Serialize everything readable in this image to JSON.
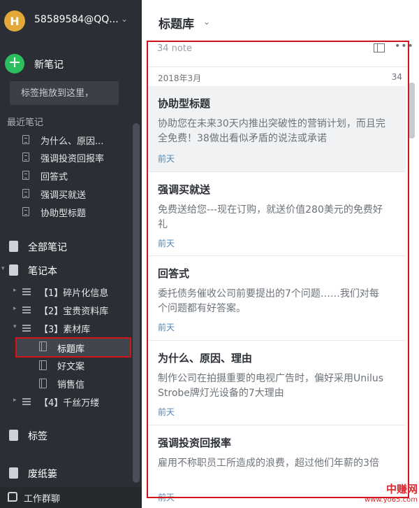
{
  "sidebar": {
    "account": "58589584@QQ...",
    "avatar_letter": "H",
    "new_note_label": "新笔记",
    "drop_hint": "标签拖放到这里，",
    "recent_label": "最近笔记",
    "recent_items": [
      {
        "label": "为什么、原因..."
      },
      {
        "label": "强调投资回报率"
      },
      {
        "label": "回答式"
      },
      {
        "label": "强调买就送"
      },
      {
        "label": "协助型标题"
      }
    ],
    "all_notes_label": "全部笔记",
    "notebooks_label": "笔记本",
    "notebooks": [
      {
        "label": "【1】碎片化信息"
      },
      {
        "label": "【2】宝贵资料库"
      },
      {
        "label": "【3】素材库"
      },
      {
        "label": "标题库"
      },
      {
        "label": "好文案"
      },
      {
        "label": "销售信"
      },
      {
        "label": "【4】千丝万缕"
      }
    ],
    "tags_label": "标签",
    "trash_label": "废纸篓",
    "work_chat_label": "工作群聊"
  },
  "list": {
    "title": "标题库",
    "note_count": "34 note",
    "group_date": "2018年3月",
    "group_count": "34",
    "notes": [
      {
        "title": "协助型标题",
        "snippet": "协助您在未来30天内推出突破性的营销计划，而且完全免费！38做出看似矛盾的说法或承诺",
        "date": "前天"
      },
      {
        "title": "强调买就送",
        "snippet": "免费送给您---现在订购，就送价值280美元的免费好礼",
        "date": "前天"
      },
      {
        "title": "回答式",
        "snippet": "委托债务催收公司前要提出的7个问题……我们对每个问题都有好答案。",
        "date": "前天"
      },
      {
        "title": "为什么、原因、理由",
        "snippet": "制作公司在拍摄重要的电视广告时，偏好采用Unilus Strobe牌灯光设备的7大理由",
        "date": "前天"
      },
      {
        "title": "强调投资回报率",
        "snippet": "雇用不称职员工所造成的浪费，超过他们年薪的3倍",
        "date": "前天"
      }
    ]
  },
  "watermark": {
    "title": "中赚网",
    "url": "www.yo65.com"
  },
  "icons": {
    "account_chevron": "chevron-down-icon",
    "title_chevron": "chevron-down-icon",
    "more": "more-icon",
    "view": "view-toggle-icon"
  },
  "colors": {
    "sidebar_bg": "#2b2f35",
    "new_note_green": "#2dbe60",
    "highlight_red": "#d4141b",
    "date_blue": "#4f87b5"
  }
}
